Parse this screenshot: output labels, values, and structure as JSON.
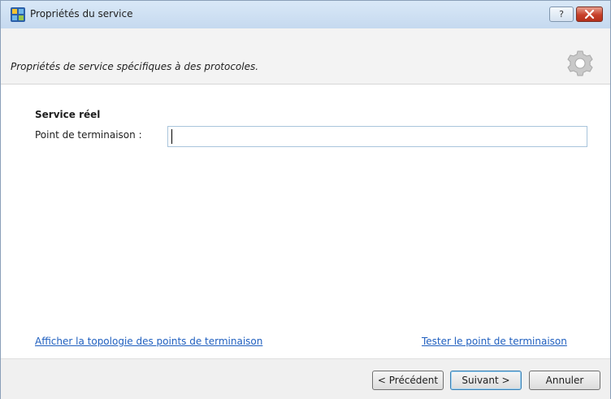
{
  "window": {
    "title": "Propriétés du service",
    "help_label": "?",
    "icons": {
      "app": "app-icon",
      "help": "help-icon",
      "close": "close-icon"
    }
  },
  "header": {
    "description": "Propriétés de service spécifiques à des protocoles.",
    "icon": "gear-icon"
  },
  "section": {
    "title": "Service réel",
    "endpoint_label": "Point de terminaison :",
    "endpoint_value": "",
    "endpoint_placeholder": ""
  },
  "links": {
    "show_topology": "Afficher la topologie des points de terminaison",
    "test_endpoint": "Tester le point de terminaison"
  },
  "buttons": {
    "previous": "< Précédent",
    "next": "Suivant >",
    "cancel": "Annuler"
  },
  "colors": {
    "link": "#1f5fbf",
    "titlebar": "#c5d9ef",
    "close": "#c7402a"
  }
}
